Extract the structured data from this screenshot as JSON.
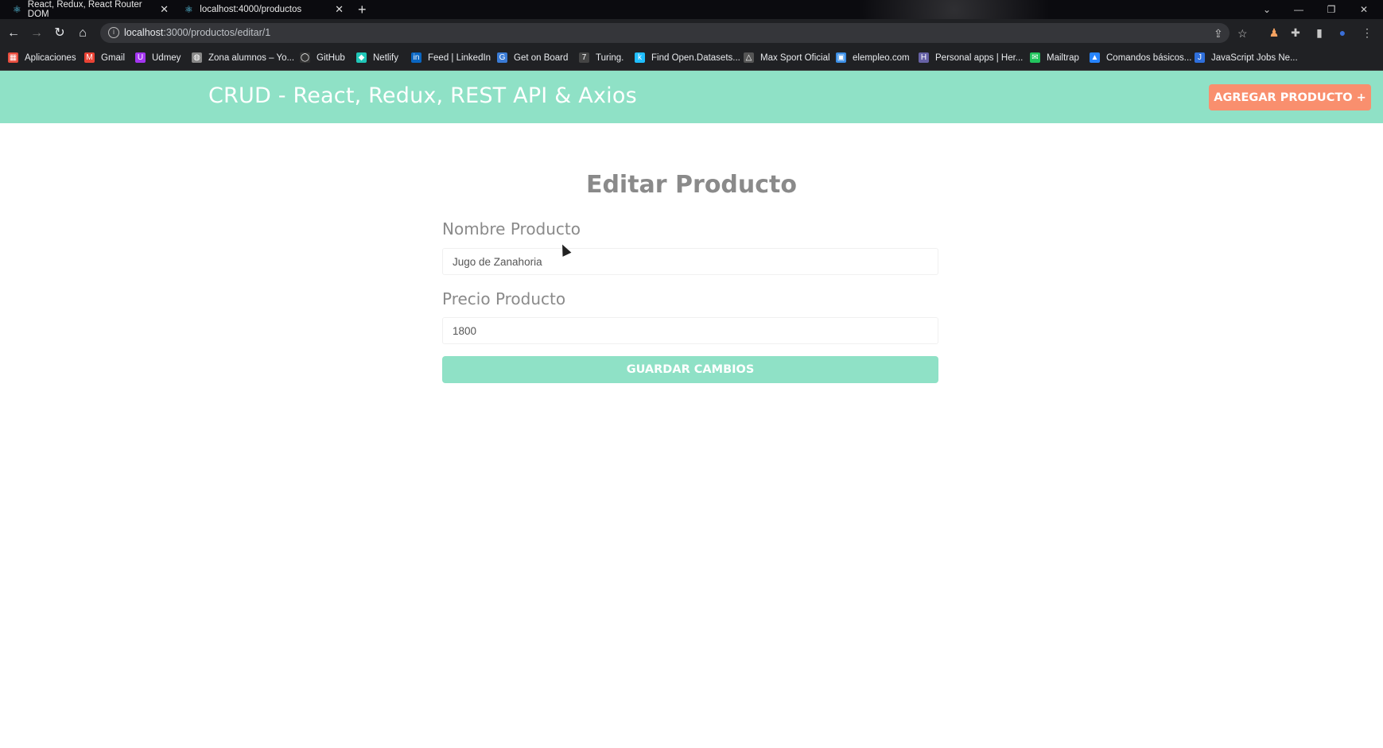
{
  "browser": {
    "tabs": [
      {
        "title": "React, Redux, React Router DOM"
      },
      {
        "title": "localhost:4000/productos"
      }
    ],
    "url_host": "localhost",
    "url_path": ":3000/productos/editar/1",
    "bookmarks": [
      {
        "label": "Aplicaciones",
        "icon": "apps-grid-icon",
        "color": "#e84c3d"
      },
      {
        "label": "Gmail",
        "icon": "gmail-icon",
        "color": "#ea4335"
      },
      {
        "label": "Udmey",
        "icon": "udemy-icon",
        "color": "#a435f0"
      },
      {
        "label": "Zona alumnos – Yo...",
        "icon": "globe-icon",
        "color": "#888888"
      },
      {
        "label": "GitHub",
        "icon": "github-icon",
        "color": "#333333"
      },
      {
        "label": "Netlify",
        "icon": "netlify-icon",
        "color": "#20c6b7"
      },
      {
        "label": "Feed | LinkedIn",
        "icon": "linkedin-icon",
        "color": "#0a66c2"
      },
      {
        "label": "Get on Board",
        "icon": "getonboard-icon",
        "color": "#3a7bd5"
      },
      {
        "label": "Turing.",
        "icon": "turing-icon",
        "color": "#444444"
      },
      {
        "label": "Find Open.Datasets...",
        "icon": "kaggle-icon",
        "color": "#20beff"
      },
      {
        "label": "Max Sport Oficial",
        "icon": "maxsport-icon",
        "color": "#555555"
      },
      {
        "label": "elempleo.com",
        "icon": "elempleo-icon",
        "color": "#3a8ee6"
      },
      {
        "label": "Personal apps | Her...",
        "icon": "heroku-icon",
        "color": "#6762a6"
      },
      {
        "label": "Mailtrap",
        "icon": "mailtrap-icon",
        "color": "#22c55e"
      },
      {
        "label": "Comandos básicos...",
        "icon": "atlassian-icon",
        "color": "#2684ff"
      },
      {
        "label": "JavaScript Jobs Ne...",
        "icon": "jsjobs-icon",
        "color": "#2f6fdb"
      }
    ]
  },
  "header": {
    "title": "CRUD - React, Redux, REST API & Axios",
    "add_button": "AGREGAR PRODUCTO +"
  },
  "form": {
    "title": "Editar Producto",
    "name_label": "Nombre Producto",
    "name_value": "Jugo de Zanahoria",
    "price_label": "Precio Producto",
    "price_value": "1800",
    "save_button": "GUARDAR CAMBIOS"
  }
}
